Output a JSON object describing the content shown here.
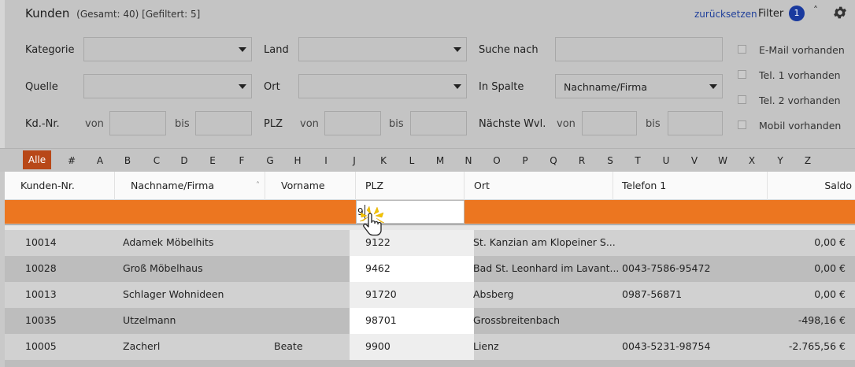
{
  "header": {
    "title": "Kunden",
    "counts": "(Gesamt: 40) [Gefiltert: 5]",
    "reset_link": "zurücksetzen",
    "filter_label": "Filter",
    "filter_count": "1"
  },
  "filters": {
    "kategorie": {
      "label": "Kategorie",
      "value": ""
    },
    "land": {
      "label": "Land",
      "value": ""
    },
    "suche_nach": {
      "label": "Suche nach",
      "value": ""
    },
    "quelle": {
      "label": "Quelle",
      "value": ""
    },
    "ort": {
      "label": "Ort",
      "value": ""
    },
    "in_spalte": {
      "label": "In Spalte",
      "value": "Nachname/Firma"
    },
    "kdnr": {
      "label": "Kd.-Nr.",
      "von": "von",
      "bis": "bis"
    },
    "plz": {
      "label": "PLZ",
      "von": "von",
      "bis": "bis"
    },
    "wvl": {
      "label": "Nächste Wvl.",
      "von": "von",
      "bis": "bis"
    },
    "checkboxes": [
      "E-Mail vorhanden",
      "Tel. 1 vorhanden",
      "Tel. 2 vorhanden",
      "Mobil vorhanden"
    ]
  },
  "alphabet": [
    "Alle",
    "#",
    "A",
    "B",
    "C",
    "D",
    "E",
    "F",
    "G",
    "H",
    "I",
    "J",
    "K",
    "L",
    "M",
    "N",
    "O",
    "P",
    "Q",
    "R",
    "S",
    "T",
    "U",
    "V",
    "W",
    "X",
    "Y",
    "Z"
  ],
  "table": {
    "columns": [
      "Kunden-Nr.",
      "Nachname/Firma",
      "Vorname",
      "PLZ",
      "Ort",
      "Telefon 1",
      "Saldo"
    ],
    "filter_plz_value": "9",
    "rows": [
      {
        "nr": "10014",
        "name": "Adamek Möbelhits",
        "vorname": "",
        "plz": "9122",
        "ort": "St. Kanzian am Klopeiner S...",
        "tel": "",
        "saldo": "0,00 €"
      },
      {
        "nr": "10028",
        "name": "Groß Möbelhaus",
        "vorname": "",
        "plz": "9462",
        "ort": "Bad St. Leonhard im Lavant...",
        "tel": "0043-7586-95472",
        "saldo": "0,00 €"
      },
      {
        "nr": "10013",
        "name": "Schlager Wohnideen",
        "vorname": "",
        "plz": "91720",
        "ort": "Absberg",
        "tel": "0987-56871",
        "saldo": "0,00 €"
      },
      {
        "nr": "10035",
        "name": "Utzelmann",
        "vorname": "",
        "plz": "98701",
        "ort": "Grossbreitenbach",
        "tel": "",
        "saldo": "-498,16 €"
      },
      {
        "nr": "10005",
        "name": "Zacherl",
        "vorname": "Beate",
        "plz": "9900",
        "ort": "Lienz",
        "tel": "0043-5231-98754",
        "saldo": "-2.765,56 €"
      }
    ]
  },
  "icons": {
    "gear": "gear-icon",
    "collapse": "chevron-up-icon",
    "cursor": "hand-pointer-icon"
  },
  "colors": {
    "accent": "#ec7620",
    "alle_active": "#b84818",
    "link": "#1f3f9a",
    "badge": "#1a3a9e"
  }
}
